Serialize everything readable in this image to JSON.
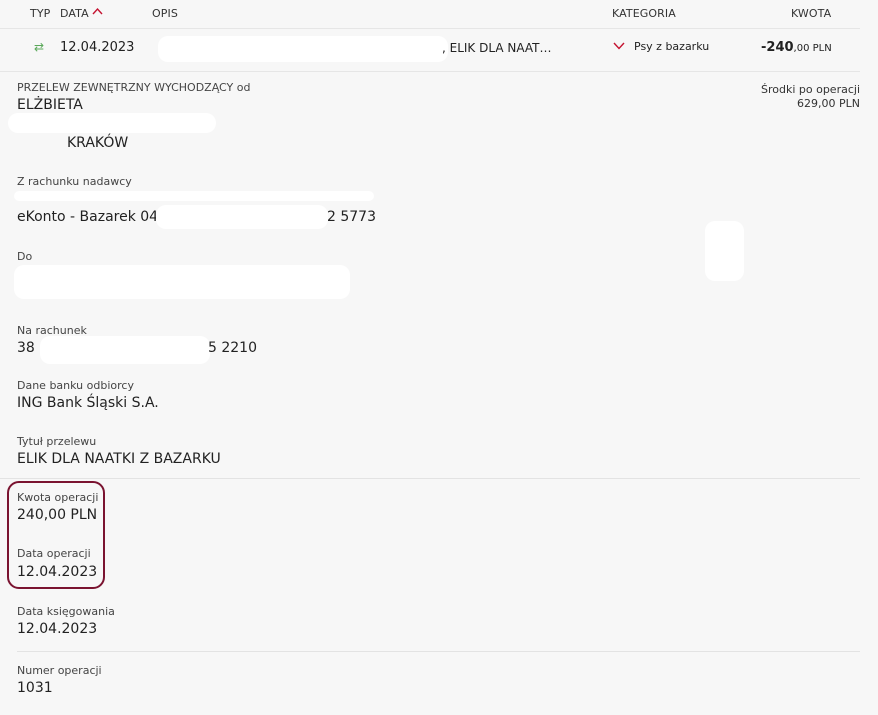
{
  "table_header": {
    "typ": "TYP",
    "data": "DATA",
    "opis": "OPIS",
    "kategoria": "KATEGORIA",
    "kwota": "KWOTA"
  },
  "transaction": {
    "date": "12.04.2023",
    "description_visible": ", ELIK DLA NAAT…",
    "category": "Psy z bazarku",
    "amount_main": "-240",
    "amount_cents": ",00 PLN"
  },
  "details": {
    "type_label": "PRZELEW ZEWNĘTRZNY WYCHODZĄCY od",
    "sender_name": "ELŻBIETA",
    "sender_city": "KRAKÓW",
    "balance_after_label": "Środki po operacji",
    "balance_after_value": "629,00 PLN",
    "from_account_label": "Z rachunku nadawcy",
    "from_account_name": "eKonto - Bazarek 04",
    "from_account_end": "2 5773",
    "to_label": "Do",
    "to_account_label": "Na rachunek",
    "to_account_start": "38",
    "to_account_end": "5 2210",
    "bank_label": "Dane banku odbiorcy",
    "bank_value": "ING Bank Śląski S.A.",
    "title_label": "Tytuł przelewu",
    "title_value": "ELIK DLA NAATKI Z BAZARKU",
    "amount_label": "Kwota operacji",
    "amount_value": "240,00 PLN",
    "op_date_label": "Data operacji",
    "op_date_value": "12.04.2023",
    "booking_date_label": "Data księgowania",
    "booking_date_value": "12.04.2023",
    "op_number_label": "Numer operacji",
    "op_number_value": "1031"
  },
  "colors": {
    "accent": "#c41230",
    "highlight": "#7a1330",
    "transfer_icon": "#5aa85a"
  },
  "icons": {
    "sort": "chevron-up-icon",
    "category": "chevron-down-icon",
    "type": "transfer-arrows-icon"
  }
}
